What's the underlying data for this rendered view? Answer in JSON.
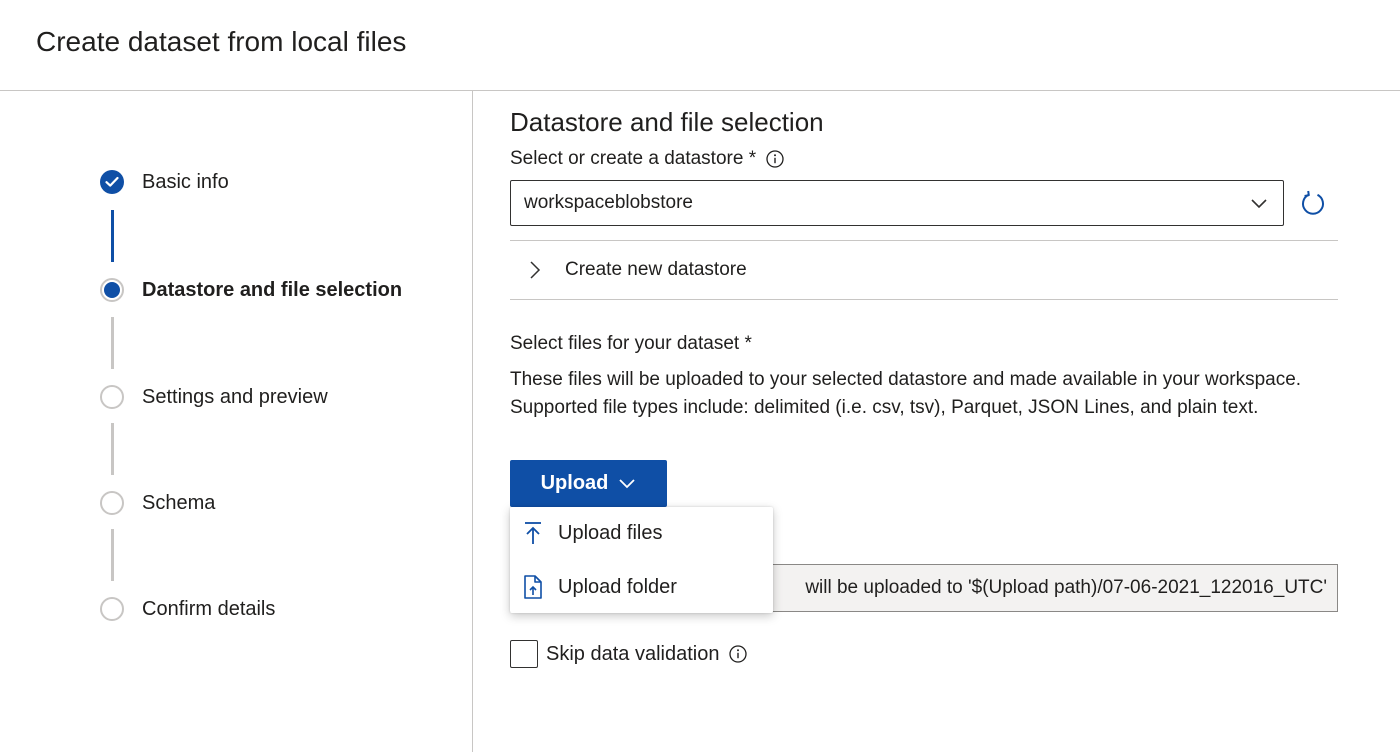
{
  "header": {
    "title": "Create dataset from local files"
  },
  "steps": [
    {
      "label": "Basic info",
      "state": "done"
    },
    {
      "label": "Datastore and file selection",
      "state": "current"
    },
    {
      "label": "Settings and preview",
      "state": "todo"
    },
    {
      "label": "Schema",
      "state": "todo"
    },
    {
      "label": "Confirm details",
      "state": "todo"
    }
  ],
  "main": {
    "title": "Datastore and file selection",
    "datastore_label": "Select or create a datastore *",
    "datastore_value": "workspaceblobstore",
    "create_datastore_label": "Create new datastore",
    "files_label": "Select files for your dataset *",
    "files_description": "These files will be uploaded to your selected datastore and made available in your workspace. Supported file types include: delimited (i.e. csv, tsv), Parquet, JSON Lines, and plain text.",
    "upload_button": "Upload",
    "upload_menu": [
      {
        "label": "Upload files",
        "icon": "upload-arrow-icon"
      },
      {
        "label": "Upload folder",
        "icon": "upload-folder-icon"
      }
    ],
    "upload_path_text": "will be uploaded to '$(Upload path)/07-06-2021_122016_UTC'",
    "skip_validation_label": "Skip data validation",
    "skip_validation_checked": false
  },
  "colors": {
    "accent": "#0f4fa6",
    "border": "#c8c6c4",
    "text": "#201f1e"
  }
}
